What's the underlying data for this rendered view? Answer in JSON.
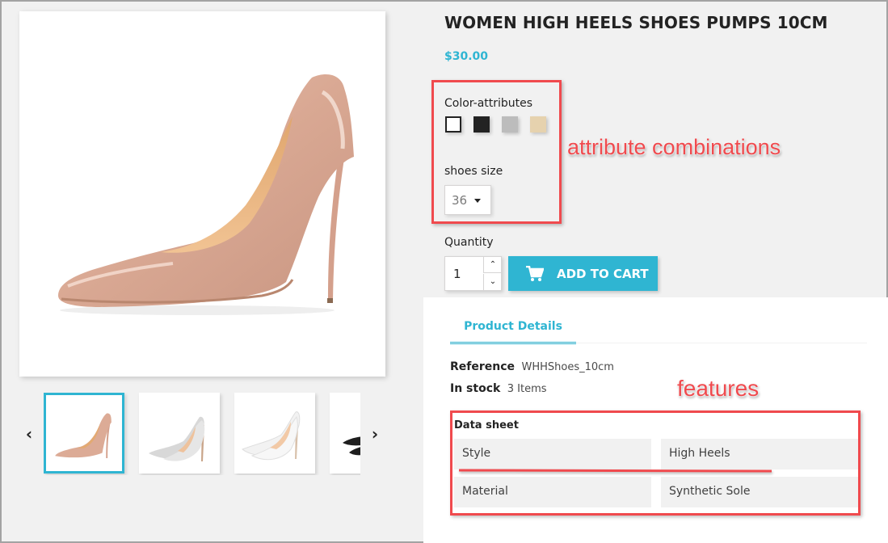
{
  "product": {
    "title": "WOMEN HIGH HEELS SHOES PUMPS 10CM",
    "price": "$30.00",
    "main_image": "nude-patent-pointed-stiletto-pump"
  },
  "gallery": {
    "prev_icon": "chevron-left-icon",
    "next_icon": "chevron-right-icon",
    "prev_glyph": "‹",
    "next_glyph": "›",
    "thumbnails": [
      {
        "name": "nude-pump",
        "selected": true
      },
      {
        "name": "silver-pump-pair",
        "selected": false
      },
      {
        "name": "white-pump-pair",
        "selected": false
      },
      {
        "name": "black-pump-pair",
        "selected": false
      }
    ],
    "selected_border_color": "#2fb5d2"
  },
  "attributes": {
    "color_label": "Color-attributes",
    "colors": [
      {
        "name": "white",
        "hex": "#ffffff",
        "selected": true
      },
      {
        "name": "black",
        "hex": "#232323",
        "selected": false
      },
      {
        "name": "grey",
        "hex": "#bcbcbc",
        "selected": false
      },
      {
        "name": "beige",
        "hex": "#e6d2ae",
        "selected": false
      }
    ],
    "size_label": "shoes size",
    "size_value": "36"
  },
  "purchase": {
    "quantity_label": "Quantity",
    "quantity_value": "1",
    "up_glyph": "⌃",
    "down_glyph": "⌄",
    "add_to_cart_label": "ADD TO CART",
    "accent_color": "#2fb5d2"
  },
  "details": {
    "tab_label": "Product Details",
    "reference_label": "Reference",
    "reference_value": "WHHShoes_10cm",
    "stock_label": "In stock",
    "stock_value": "3 Items",
    "data_sheet_title": "Data sheet",
    "features": [
      {
        "name": "Style",
        "value": "High Heels"
      },
      {
        "name": "Material",
        "value": "Synthetic Sole"
      }
    ]
  },
  "annotations": {
    "attribute_combinations": "attribute combinations",
    "features": "features",
    "color": "#f04a4e"
  }
}
